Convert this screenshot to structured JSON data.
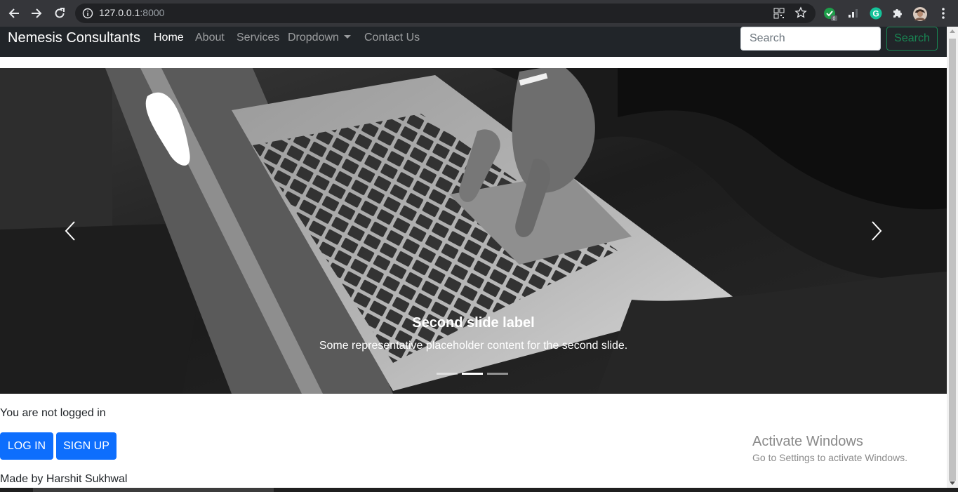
{
  "browser": {
    "url_host": "127.0.0.1",
    "url_port": ":8000",
    "back_icon": "arrow-left-icon",
    "forward_icon": "arrow-right-icon",
    "reload_icon": "reload-icon",
    "extension_badge": "0"
  },
  "navbar": {
    "brand": "Nemesis Consultants",
    "links": [
      "Home",
      "About",
      "Services",
      "Dropdown",
      "Contact Us"
    ],
    "active_link": "Home",
    "search_placeholder": "Search",
    "search_button": "Search"
  },
  "carousel": {
    "caption_title": "Second slide label",
    "caption_text": "Some representative placeholder content for the second slide.",
    "slide_count": 3,
    "active_slide": 2
  },
  "main": {
    "status_text": "You are not logged in",
    "login_label": "LOG IN",
    "signup_label": "SIGN UP"
  },
  "footer": {
    "text": "Made by Harshit Sukhwal"
  },
  "watermark": {
    "line1": "Activate Windows",
    "line2": "Go to Settings to activate Windows."
  },
  "colors": {
    "navbar_bg": "#212529",
    "primary": "#0d6efd",
    "success": "#198754"
  }
}
